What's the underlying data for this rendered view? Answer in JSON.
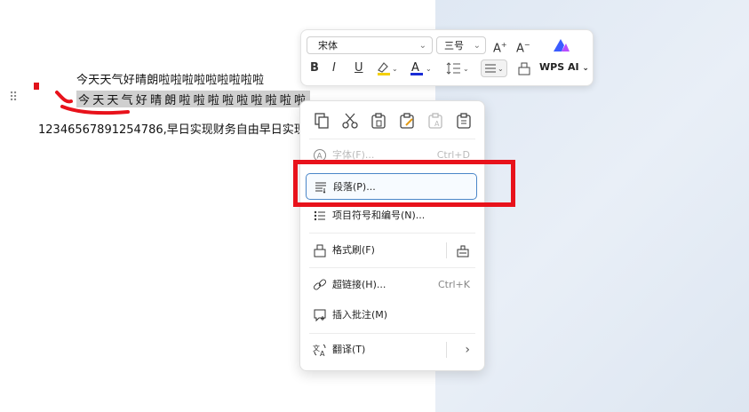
{
  "document": {
    "line1": "今天天气好晴朗啦啦啦啦啦啦啦啦啦",
    "line2": "今天天气好晴朗啦啦啦啦啦啦啦啦啦",
    "line3": "1234656789125478​6,早日实现财务自由早日实现"
  },
  "toolbar": {
    "font_name": "宋体",
    "font_size": "三号",
    "bold": "B",
    "italic": "I",
    "underline": "U",
    "wps_ai": "WPS AI"
  },
  "menu": {
    "font": {
      "label": "字体(F)...",
      "shortcut": "Ctrl+D"
    },
    "paragraph": {
      "label": "段落(P)..."
    },
    "bullets": {
      "label": "项目符号和编号(N)..."
    },
    "format_painter": {
      "label": "格式刷(F)"
    },
    "hyperlink": {
      "label": "超链接(H)...",
      "shortcut": "Ctrl+K"
    },
    "comment": {
      "label": "插入批注(M)"
    },
    "translate": {
      "label": "翻译(T)",
      "arrow": "›"
    }
  },
  "colors": {
    "highlight_red": "#e8121b",
    "accent_blue": "#4a86c8"
  }
}
